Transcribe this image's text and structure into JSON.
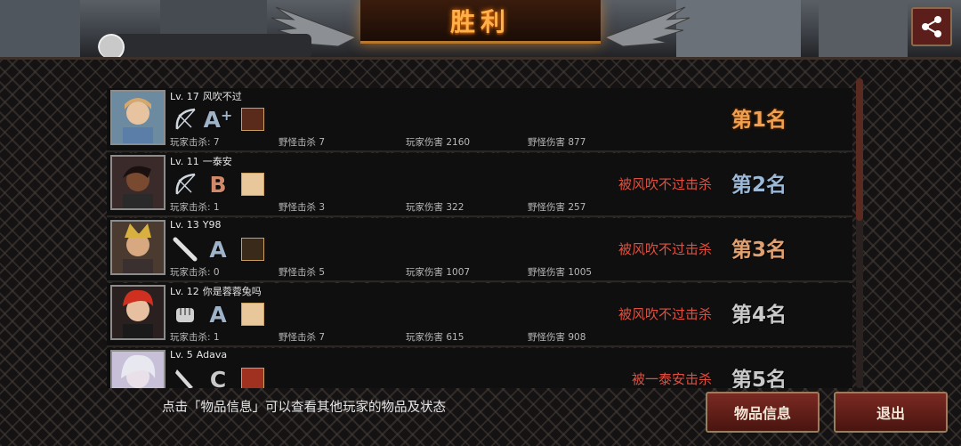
{
  "header": {
    "title": "胜利",
    "player_name_partial": "风吹不过"
  },
  "share": {
    "icon": "share-icon"
  },
  "rows": [
    {
      "level": "Lv. 17",
      "name": "风吹不过",
      "weapon": "bow-icon",
      "grade": "A",
      "grade_plus": "+",
      "item": "item-icon",
      "kill_note": "",
      "rank": "第1名",
      "stats": {
        "player_kills": "玩家击杀: 7",
        "monster_kills": "野怪击杀 7",
        "player_damage": "玩家伤害 2160",
        "monster_damage": "野怪伤害 877"
      }
    },
    {
      "level": "Lv. 11",
      "name": "一泰安",
      "weapon": "bow-icon",
      "grade": "B",
      "grade_plus": "",
      "item": "item-icon",
      "kill_note": "被风吹不过击杀",
      "rank": "第2名",
      "stats": {
        "player_kills": "玩家击杀: 1",
        "monster_kills": "野怪击杀 3",
        "player_damage": "玩家伤害 322",
        "monster_damage": "野怪伤害 257"
      }
    },
    {
      "level": "Lv. 13",
      "name": "Y98",
      "weapon": "bat-icon",
      "grade": "A",
      "grade_plus": "",
      "item": "item-icon",
      "kill_note": "被风吹不过击杀",
      "rank": "第3名",
      "stats": {
        "player_kills": "玩家击杀: 0",
        "monster_kills": "野怪击杀 5",
        "player_damage": "玩家伤害 1007",
        "monster_damage": "野怪伤害 1005"
      }
    },
    {
      "level": "Lv. 12",
      "name": "你是蓉蓉兔吗",
      "weapon": "fist-icon",
      "grade": "A",
      "grade_plus": "",
      "item": "item-icon",
      "kill_note": "被风吹不过击杀",
      "rank": "第4名",
      "stats": {
        "player_kills": "玩家击杀: 1",
        "monster_kills": "野怪击杀 7",
        "player_damage": "玩家伤害 615",
        "monster_damage": "野怪伤害 908"
      }
    },
    {
      "level": "Lv. 5",
      "name": "Adava",
      "weapon": "knife-icon",
      "grade": "C",
      "grade_plus": "",
      "item": "item-icon",
      "kill_note": "被一泰安击杀",
      "rank": "第5名",
      "stats": {
        "player_kills": "",
        "monster_kills": "",
        "player_damage": "",
        "monster_damage": ""
      }
    }
  ],
  "footer": {
    "hint": "点击「物品信息」可以查看其他玩家的物品及状态",
    "items_button": "物品信息",
    "exit_button": "退出"
  },
  "colors": {
    "title": "#ffb04a",
    "kill_note": "#e05040",
    "rank_first": "#f0a050"
  }
}
